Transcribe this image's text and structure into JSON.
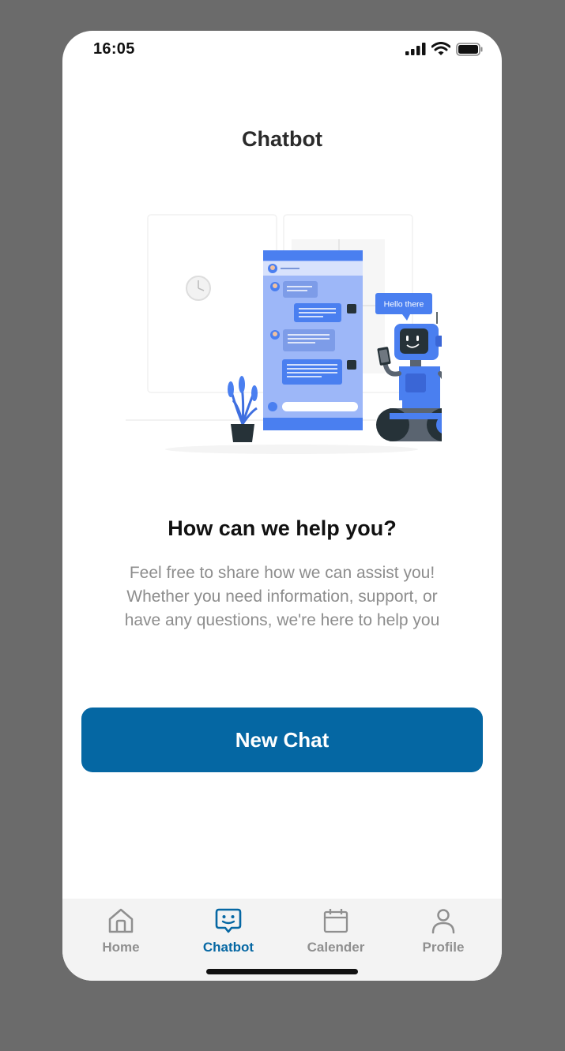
{
  "status_bar": {
    "time": "16:05",
    "icons": [
      "signal-icon",
      "wifi-icon",
      "battery-icon"
    ]
  },
  "header": {
    "title": "Chatbot"
  },
  "illustration": {
    "speech_bubble": "Hello there"
  },
  "main": {
    "heading": "How can we help you?",
    "description_lines": [
      "Feel free to share how we can assist you!",
      "Whether you need information, support, or",
      "have any questions, we're here to help you"
    ],
    "new_chat_label": "New Chat"
  },
  "tabs": [
    {
      "label": "Home",
      "icon": "home-icon",
      "active": false
    },
    {
      "label": "Chatbot",
      "icon": "chatbot-icon",
      "active": true
    },
    {
      "label": "Calender",
      "icon": "calendar-icon",
      "active": false
    },
    {
      "label": "Profile",
      "icon": "profile-icon",
      "active": false
    }
  ],
  "colors": {
    "accent": "#0567a3",
    "illustration_blue": "#4a7ff0",
    "inactive_tab": "#8f8f8f",
    "background": "#6b6b6b"
  }
}
